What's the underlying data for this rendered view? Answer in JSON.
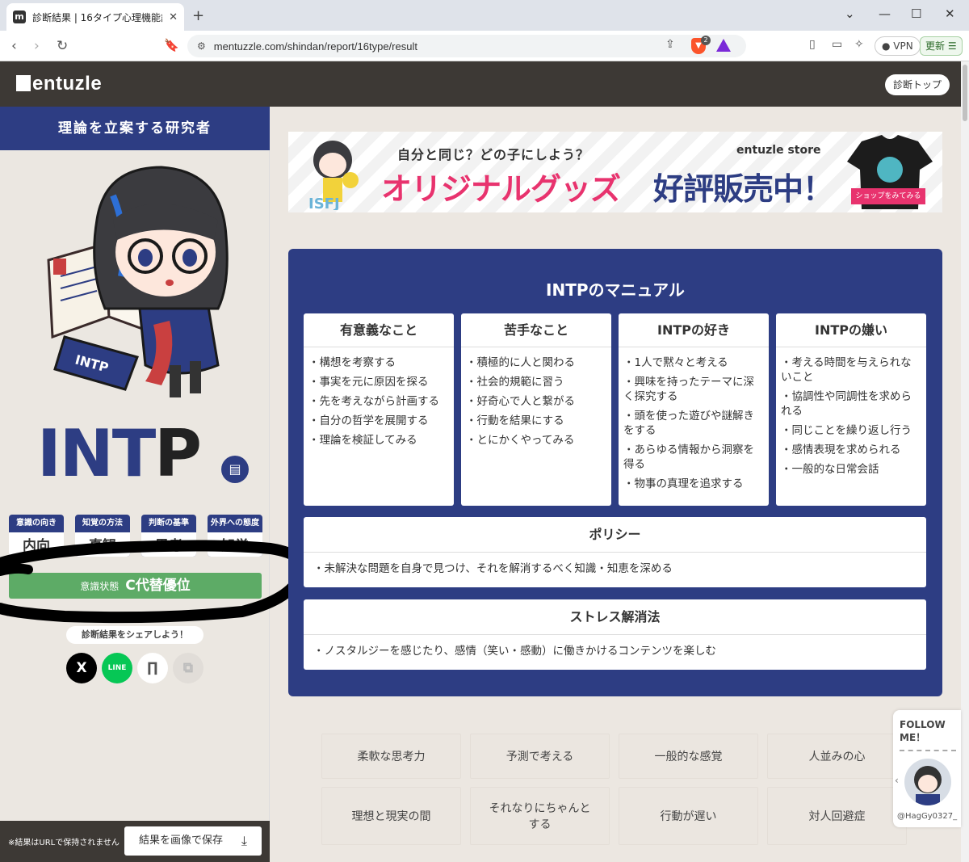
{
  "browser": {
    "tab_title": "診断結果 | 16タイプ心理機能診断",
    "url": "mentuzzle.com/shindan/report/16type/result",
    "vpn_label": "VPN",
    "update_label": "更新",
    "brave_count": "2"
  },
  "site": {
    "logo": "entuzle",
    "top_button": "診断トップ"
  },
  "left": {
    "type_title": "理論を立案する研究者",
    "type_code_main": "INT",
    "type_code_last": "P",
    "axes": [
      {
        "label": "意識の向き",
        "value": "内向"
      },
      {
        "label": "知覚の方法",
        "value": "直観"
      },
      {
        "label": "判断の基準",
        "value": "思考"
      },
      {
        "label": "外界への態度",
        "value": "知覚"
      }
    ],
    "conscious_label": "意識状態",
    "conscious_value": "C代替優位",
    "share_label": "診断結果をシェアしよう！",
    "share_icons": {
      "x": "X",
      "line": "LINE"
    },
    "footer_note": "※結果はURLで保持されません",
    "save_button": "結果を画像で保存"
  },
  "banner": {
    "sub": "自分と同じ？どの子にしよう？",
    "main_pink": "オリジナルグッズ",
    "main_navy": "好評販売中！",
    "store": "entuzle store",
    "shop_button": "ショップをみてみる"
  },
  "manual": {
    "title": "INTPのマニュアル",
    "cards": [
      {
        "title": "有意義なこと",
        "items": [
          "・構想を考察する",
          "・事実を元に原因を探る",
          "・先を考えながら計画する",
          "・自分の哲学を展開する",
          "・理論を検証してみる"
        ]
      },
      {
        "title": "苦手なこと",
        "items": [
          "・積極的に人と関わる",
          "・社会的規範に習う",
          "・好奇心で人と繋がる",
          "・行動を結果にする",
          "・とにかくやってみる"
        ]
      },
      {
        "title": "INTPの好き",
        "items": [
          "・1人で黙々と考える",
          "・興味を持ったテーマに深く探究する",
          "・頭を使った遊びや謎解きをする",
          "・あらゆる情報から洞察を得る",
          "・物事の真理を追求する"
        ]
      },
      {
        "title": "INTPの嫌い",
        "items": [
          "・考える時間を与えられないこと",
          "・協調性や同調性を求められる",
          "・同じことを繰り返し行う",
          "・感情表現を求められる",
          "・一般的な日常会話"
        ]
      }
    ],
    "policy_title": "ポリシー",
    "policy_text": "・未解決な問題を自身で見つけ、それを解消するべく知識・知恵を深める",
    "stress_title": "ストレス解消法",
    "stress_text": "・ノスタルジーを感じたり、感情（笑い・感動）に働きかけるコンテンツを楽しむ"
  },
  "tags": [
    "柔軟な思考力",
    "予測で考える",
    "一般的な感覚",
    "人並みの心",
    "理想と現実の間",
    "それなりにちゃんとする",
    "行動が遅い",
    "対人回避症"
  ],
  "follow": {
    "label": "FOLLOW ME！",
    "handle": "@HagGy0327_"
  }
}
